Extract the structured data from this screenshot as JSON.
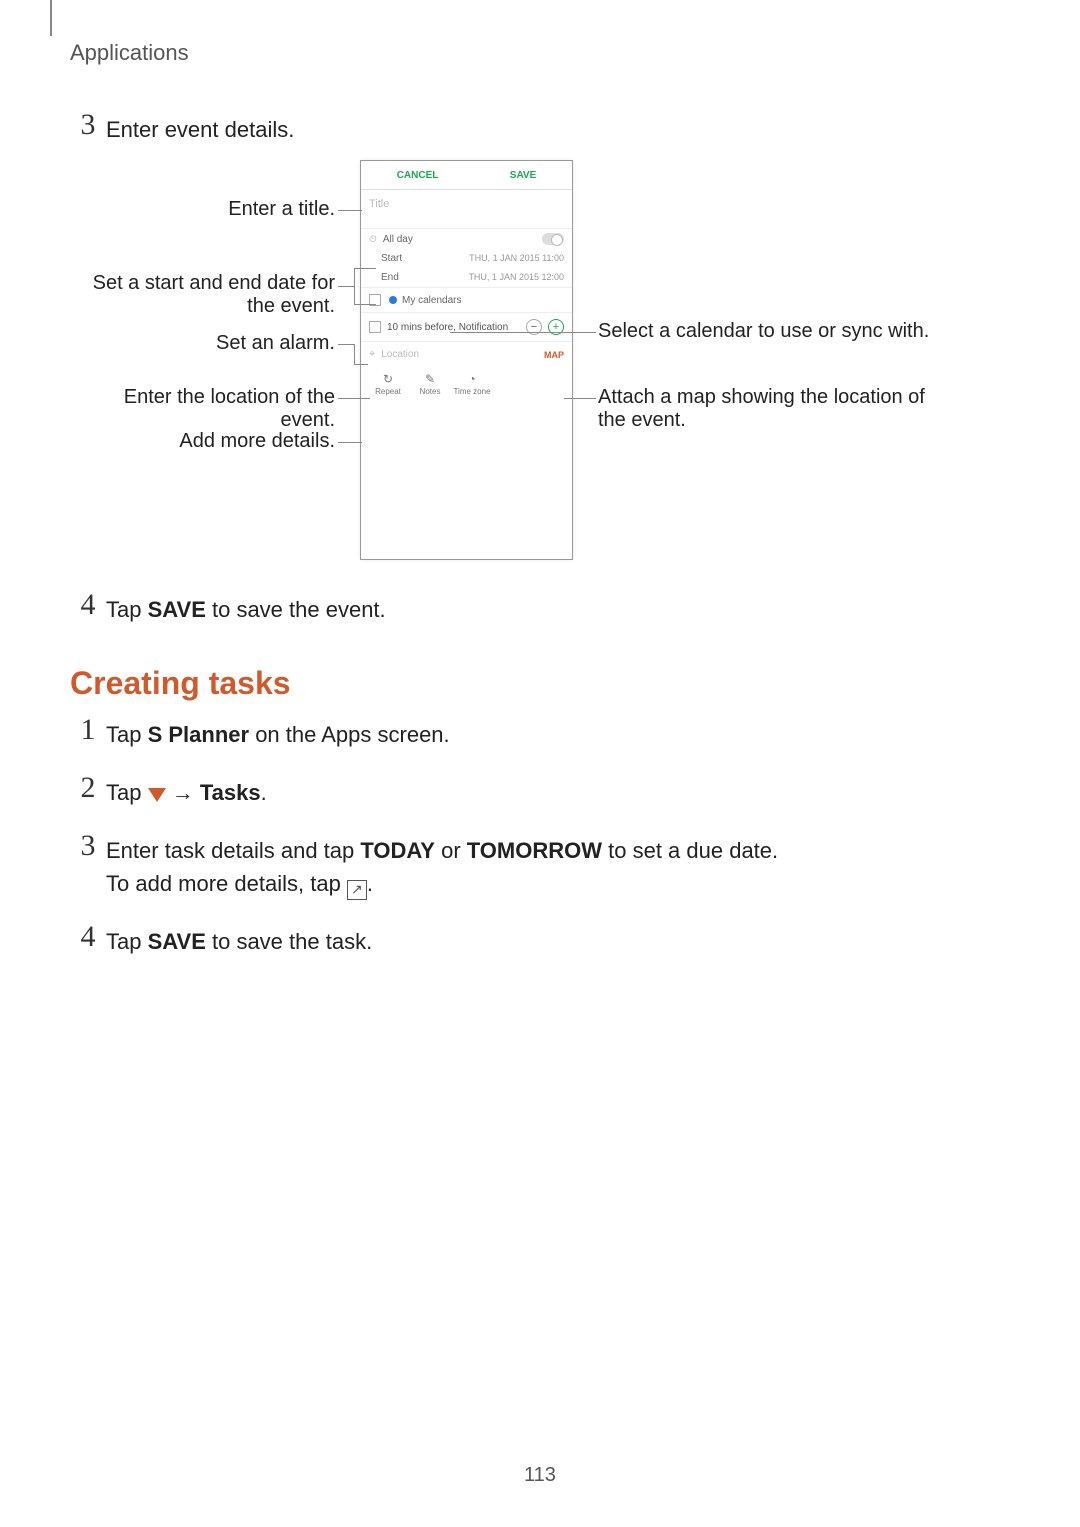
{
  "header": {
    "section": "Applications"
  },
  "step3": {
    "num": "3",
    "text": "Enter event details."
  },
  "figure": {
    "phone": {
      "cancel": "CANCEL",
      "save": "SAVE",
      "title_placeholder": "Title",
      "allday_icon": "⏲",
      "allday": "All day",
      "start_label": "Start",
      "start_value": "THU, 1 JAN 2015   11:00",
      "end_label": "End",
      "end_value": "THU, 1 JAN 2015   12:00",
      "mycal": "My calendars",
      "alarm_text": "10 mins before, Notification",
      "minus": "−",
      "plus": "+",
      "location_placeholder": "Location",
      "map": "MAP",
      "repeat": "Repeat",
      "notes": "Notes",
      "timezone": "Time zone"
    },
    "callouts": {
      "title": "Enter a title.",
      "dates": "Set a start and end date for the event.",
      "alarm": "Set an alarm.",
      "location": "Enter the location of the event.",
      "more": "Add more details.",
      "calendar": "Select a calendar to use or sync with.",
      "map": "Attach a map showing the location of the event."
    }
  },
  "step4": {
    "num": "4",
    "pre": "Tap ",
    "bold": "SAVE",
    "post": " to save the event."
  },
  "tasks": {
    "heading": "Creating tasks",
    "s1": {
      "num": "1",
      "pre": "Tap ",
      "bold": "S Planner",
      "post": " on the Apps screen."
    },
    "s2": {
      "num": "2",
      "pre": "Tap ",
      "arrow": " → ",
      "bold": "Tasks",
      "post": "."
    },
    "s3": {
      "num": "3",
      "line1_pre": "Enter task details and tap ",
      "line1_b1": "TODAY",
      "line1_mid": " or ",
      "line1_b2": "TOMORROW",
      "line1_post": " to set a due date.",
      "line2_pre": "To add more details, tap ",
      "line2_post": "."
    },
    "s4": {
      "num": "4",
      "pre": "Tap ",
      "bold": "SAVE",
      "post": " to save the task."
    }
  },
  "page_number": "113"
}
